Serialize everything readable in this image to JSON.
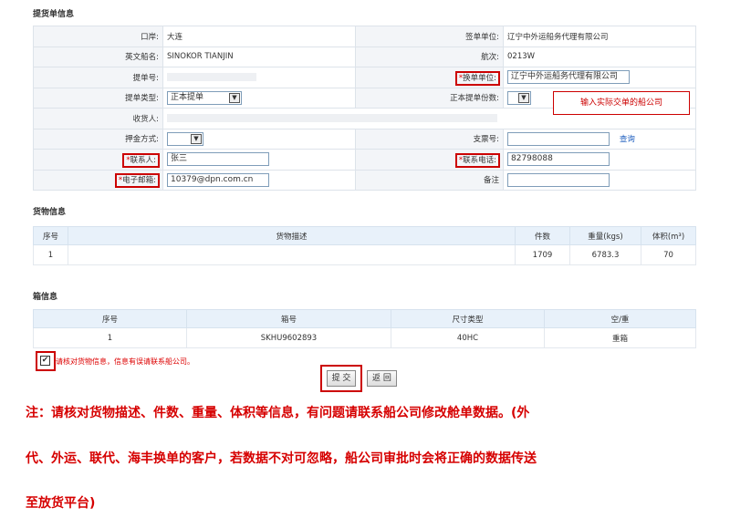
{
  "sections": {
    "bill": "提货单信息",
    "cargo": "货物信息",
    "box": "箱信息"
  },
  "form": {
    "port_label": "口岸:",
    "port_value": "大连",
    "signer_label": "签单单位:",
    "signer_value": "辽宁中外运船务代理有限公司",
    "ship_label": "英文船名:",
    "ship_value": "SINOKOR TIANJIN",
    "voyage_label": "航次:",
    "voyage_value": "0213W",
    "bill_no_label": "提单号:",
    "exchange_label": "*换单单位:",
    "exchange_value": "辽宁中外运船务代理有限公司",
    "bill_type_label": "提单类型:",
    "bill_type_value": "正本提单",
    "orig_copies_label": "正本提单份数:",
    "consignee_label": "收货人:",
    "deposit_label": "押金方式:",
    "cheque_label": "支票号:",
    "query_link": "查询",
    "contact_label": "*联系人:",
    "contact_value": "张三",
    "phone_label": "*联系电话:",
    "phone_value": "82798088",
    "email_label": "*电子邮箱:",
    "email_value": "10379@dpn.com.cn",
    "remark_label": "备注"
  },
  "callout": "输入实际交单的船公司",
  "cargo_table": {
    "headers": [
      "序号",
      "货物描述",
      "件数",
      "重量(kgs)",
      "体积(m³)"
    ],
    "rows": [
      [
        "1",
        "",
        "1709",
        "6783.3",
        "70"
      ]
    ]
  },
  "box_table": {
    "headers": [
      "序号",
      "箱号",
      "尺寸类型",
      "空/重"
    ],
    "rows": [
      [
        "1",
        "SKHU9602893",
        "40HC",
        "重箱"
      ]
    ]
  },
  "confirm_text": "请核对货物信息，信息有误请联系船公司。",
  "buttons": {
    "submit": "提 交",
    "back": "返 回"
  },
  "note": {
    "line1": "注：请核对货物描述、件数、重量、体积等信息，有问题请联系船公司修改舱单数据。(外",
    "line2": "代、外运、联代、海丰换单的客户，若数据不对可忽略，船公司审批时会将正确的数据传送",
    "line3": "至放货平台)"
  }
}
